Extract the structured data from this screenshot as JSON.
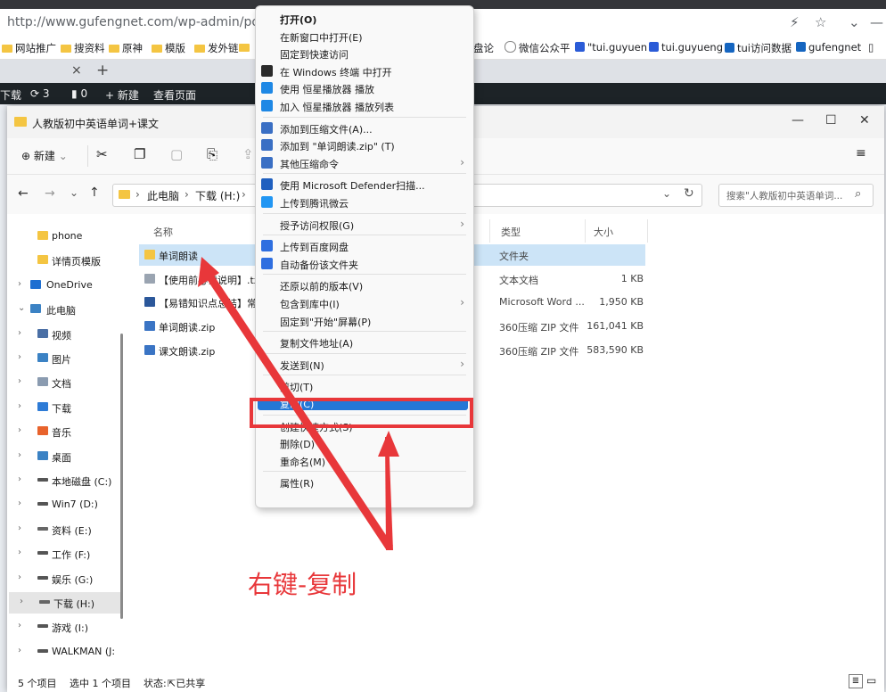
{
  "browser": {
    "url": "http://www.gufengnet.com/wp-admin/post.php",
    "bookmarks": [
      "网站推广",
      "搜资料",
      "原神",
      "模版",
      "发外链"
    ],
    "bookmarks_right": [
      "盘论",
      "微信公众平",
      "\"tui.guyuen",
      "tui.guyueng",
      "tui访问数据",
      "gufengnet"
    ],
    "tab_close": "×",
    "tab_new": "+",
    "wp": {
      "download": "下载",
      "updates": "3",
      "comments": "0",
      "new": "新建",
      "view": "查看页面"
    }
  },
  "explorer": {
    "title": "人教版初中英语单词+课文",
    "new_label": "新建",
    "path": [
      "此电脑",
      "下载 (H:)"
    ],
    "search_placeholder": "搜索\"人教版初中英语单词...",
    "columns": {
      "name": "名称",
      "type": "类型",
      "size": "大小"
    },
    "nav": [
      {
        "label": "phone",
        "icon": "folder-icon",
        "indent": 2,
        "expand": ""
      },
      {
        "label": "详情页模版",
        "icon": "folder-icon",
        "indent": 2,
        "expand": ""
      },
      {
        "label": "OneDrive",
        "icon": "cloud-icon",
        "indent": 1,
        "expand": "›"
      },
      {
        "label": "此电脑",
        "icon": "pc-icon",
        "indent": 1,
        "expand": "⌄"
      },
      {
        "label": "视频",
        "icon": "video-icon",
        "indent": 2,
        "expand": "›"
      },
      {
        "label": "图片",
        "icon": "picture-icon",
        "indent": 2,
        "expand": "›"
      },
      {
        "label": "文档",
        "icon": "document-icon",
        "indent": 2,
        "expand": "›"
      },
      {
        "label": "下载",
        "icon": "download-icon",
        "indent": 2,
        "expand": "›"
      },
      {
        "label": "音乐",
        "icon": "music-icon",
        "indent": 2,
        "expand": "›"
      },
      {
        "label": "桌面",
        "icon": "desktop-icon",
        "indent": 2,
        "expand": "›"
      },
      {
        "label": "本地磁盘 (C:)",
        "icon": "drive-icon",
        "indent": 2,
        "expand": "›"
      },
      {
        "label": "Win7 (D:)",
        "icon": "drive-icon",
        "indent": 2,
        "expand": "›"
      },
      {
        "label": "资料 (E:)",
        "icon": "network-drive-icon",
        "indent": 2,
        "expand": "›"
      },
      {
        "label": "工作 (F:)",
        "icon": "drive-icon",
        "indent": 2,
        "expand": "›"
      },
      {
        "label": "娱乐 (G:)",
        "icon": "drive-icon",
        "indent": 2,
        "expand": "›"
      },
      {
        "label": "下载 (H:)",
        "icon": "network-drive-icon",
        "indent": 2,
        "expand": "›"
      },
      {
        "label": "游戏 (I:)",
        "icon": "drive-icon",
        "indent": 2,
        "expand": "›"
      },
      {
        "label": "WALKMAN (J:",
        "icon": "drive-icon",
        "indent": 2,
        "expand": "›"
      }
    ],
    "files": [
      {
        "name": "单词朗读",
        "type": "文件夹",
        "size": "",
        "icon": "folder-icon"
      },
      {
        "name": "【使用前必读说明】.txt",
        "type": "文本文档",
        "size": "1 KB",
        "icon": "text-file-icon"
      },
      {
        "name": "【易错知识点总结】常考",
        "type": "Microsoft Word ...",
        "size": "1,950 KB",
        "icon": "word-file-icon"
      },
      {
        "name": "单词朗读.zip",
        "type": "360压缩 ZIP 文件",
        "size": "161,041 KB",
        "icon": "zip-file-icon"
      },
      {
        "name": "课文朗读.zip",
        "type": "360压缩 ZIP 文件",
        "size": "583,590 KB",
        "icon": "zip-file-icon"
      }
    ],
    "status": {
      "count": "5 个项目",
      "selected": "选中 1 个项目",
      "state_label": "状态:",
      "shared": "已共享"
    }
  },
  "context_menu": {
    "items": [
      {
        "label": "打开(O)",
        "icon": "",
        "sub": false,
        "bold": true
      },
      {
        "label": "在新窗口中打开(E)",
        "icon": "",
        "sub": false
      },
      {
        "label": "固定到快速访问",
        "icon": "",
        "sub": false
      },
      {
        "label": "在 Windows 终端 中打开",
        "icon": "terminal-icon",
        "sub": false
      },
      {
        "label": "使用 恒星播放器 播放",
        "icon": "player-icon",
        "sub": false
      },
      {
        "label": "加入 恒星播放器 播放列表",
        "icon": "player-icon",
        "sub": false
      },
      {
        "sep": true
      },
      {
        "label": "添加到压缩文件(A)...",
        "icon": "archive-icon",
        "sub": false
      },
      {
        "label": "添加到 \"单词朗读.zip\" (T)",
        "icon": "archive-icon",
        "sub": false
      },
      {
        "label": "其他压缩命令",
        "icon": "archive-icon",
        "sub": true
      },
      {
        "sep": true
      },
      {
        "label": "使用 Microsoft Defender扫描...",
        "icon": "defender-icon",
        "sub": false
      },
      {
        "label": "上传到腾讯微云",
        "icon": "cloud-upload-icon",
        "sub": false
      },
      {
        "sep": true
      },
      {
        "label": "授予访问权限(G)",
        "icon": "",
        "sub": true
      },
      {
        "sep": true
      },
      {
        "label": "上传到百度网盘",
        "icon": "baidu-icon",
        "sub": false
      },
      {
        "label": "自动备份该文件夹",
        "icon": "baidu-icon",
        "sub": false
      },
      {
        "sep": true
      },
      {
        "label": "还原以前的版本(V)",
        "icon": "",
        "sub": false
      },
      {
        "label": "包含到库中(I)",
        "icon": "",
        "sub": true
      },
      {
        "label": "固定到\"开始\"屏幕(P)",
        "icon": "",
        "sub": false
      },
      {
        "sep": true
      },
      {
        "label": "复制文件地址(A)",
        "icon": "",
        "sub": false
      },
      {
        "sep": true
      },
      {
        "label": "发送到(N)",
        "icon": "",
        "sub": true
      },
      {
        "sep": true
      },
      {
        "label": "剪切(T)",
        "icon": "",
        "sub": false
      },
      {
        "label": "复制(C)",
        "icon": "",
        "sub": false,
        "highlight": true
      },
      {
        "sep": true
      },
      {
        "label": "创建快捷方式(S)",
        "icon": "",
        "sub": false
      },
      {
        "label": "删除(D)",
        "icon": "",
        "sub": false
      },
      {
        "label": "重命名(M)",
        "icon": "",
        "sub": false
      },
      {
        "sep": true
      },
      {
        "label": "属性(R)",
        "icon": "",
        "sub": false
      }
    ]
  },
  "annotation": {
    "caption": "右键-复制",
    "color": "#e8373a"
  },
  "colors": {
    "accent": "#2477d6",
    "folder": "#f4c542",
    "selected_row": "#cce4f7"
  }
}
